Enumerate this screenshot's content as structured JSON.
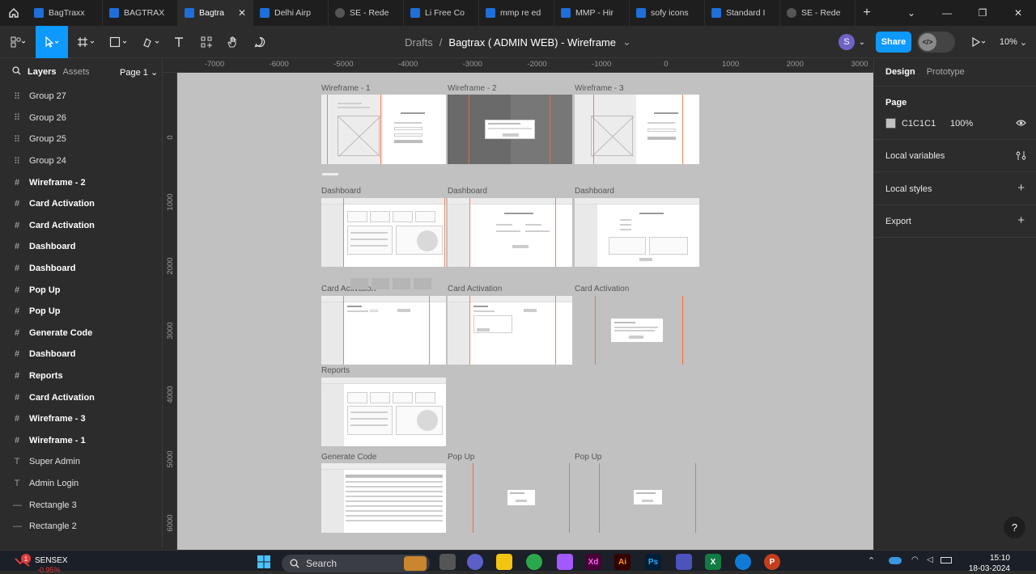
{
  "tabs": [
    {
      "label": "BagTraxx",
      "icon": "figma-file-icon",
      "active": false
    },
    {
      "label": "BAGTRAX",
      "icon": "figma-file-icon",
      "active": false
    },
    {
      "label": "Bagtra",
      "icon": "figma-file-icon",
      "active": true
    },
    {
      "label": "Delhi Airp",
      "icon": "figma-file-icon",
      "active": false
    },
    {
      "label": "SE - Rede",
      "icon": "play-icon",
      "active": false
    },
    {
      "label": "Li Free Co",
      "icon": "figma-file-icon",
      "active": false
    },
    {
      "label": "mmp re ed",
      "icon": "figma-file-icon",
      "active": false
    },
    {
      "label": "MMP - Hir",
      "icon": "figma-file-icon",
      "active": false
    },
    {
      "label": "sofy icons",
      "icon": "figma-file-icon",
      "active": false
    },
    {
      "label": "Standard I",
      "icon": "figma-file-icon",
      "active": false
    },
    {
      "label": "SE - Rede",
      "icon": "play-icon",
      "active": false
    }
  ],
  "header": {
    "drafts": "Drafts",
    "separator": "/",
    "file_name": "Bagtrax ( ADMIN WEB) - Wireframe",
    "avatar_initial": "S",
    "share_label": "Share",
    "zoom": "10%"
  },
  "left_panel": {
    "layers_tab": "Layers",
    "assets_tab": "Assets",
    "page_selector": "Page 1",
    "layers": [
      {
        "label": "Group 27",
        "type": "group"
      },
      {
        "label": "Group 26",
        "type": "group"
      },
      {
        "label": "Group 25",
        "type": "group"
      },
      {
        "label": "Group 24",
        "type": "group"
      },
      {
        "label": "Wireframe - 2",
        "type": "frame"
      },
      {
        "label": "Card Activation",
        "type": "frame"
      },
      {
        "label": "Card Activation",
        "type": "frame"
      },
      {
        "label": "Dashboard",
        "type": "frame"
      },
      {
        "label": "Dashboard",
        "type": "frame"
      },
      {
        "label": "Pop Up",
        "type": "frame"
      },
      {
        "label": "Pop Up",
        "type": "frame"
      },
      {
        "label": "Generate Code",
        "type": "frame"
      },
      {
        "label": "Dashboard",
        "type": "frame"
      },
      {
        "label": "Reports",
        "type": "frame"
      },
      {
        "label": "Card Activation",
        "type": "frame"
      },
      {
        "label": "Wireframe - 3",
        "type": "frame"
      },
      {
        "label": "Wireframe - 1",
        "type": "frame"
      },
      {
        "label": "Super Admin",
        "type": "text"
      },
      {
        "label": "Admin Login",
        "type": "text"
      },
      {
        "label": "Rectangle 3",
        "type": "rect"
      },
      {
        "label": "Rectangle 2",
        "type": "rect"
      }
    ]
  },
  "rulers": {
    "top": [
      "-7000",
      "-6000",
      "-5000",
      "-4000",
      "-3000",
      "-2000",
      "-1000",
      "0",
      "1000",
      "2000",
      "3000"
    ],
    "left": [
      "0",
      "1000",
      "2000",
      "3000",
      "4000",
      "5000",
      "6000"
    ]
  },
  "canvas": {
    "background": "#C1C1C1",
    "frame_titles": [
      "Wireframe - 1",
      "Wireframe - 2",
      "Wireframe - 3",
      "Dashboard",
      "Dashboard",
      "Dashboard",
      "Card Activation",
      "Card Activation",
      "Card Activation",
      "Reports",
      "Generate Code",
      "Pop Up",
      "Pop Up"
    ]
  },
  "right_panel": {
    "design_tab": "Design",
    "prototype_tab": "Prototype",
    "page_heading": "Page",
    "page_color": "C1C1C1",
    "page_opacity": "100%",
    "local_variables": "Local variables",
    "local_styles": "Local styles",
    "export": "Export"
  },
  "taskbar": {
    "ticker_name": "SENSEX",
    "ticker_change": "-0.95%",
    "notification_count": "1",
    "search_placeholder": "Search",
    "time": "15:10",
    "date": "18-03-2024"
  },
  "colors": {
    "accent": "#0D99FF",
    "canvas": "#C1C1C1",
    "panel": "#2C2C2C",
    "frame_guide": "#FF6A3D"
  }
}
